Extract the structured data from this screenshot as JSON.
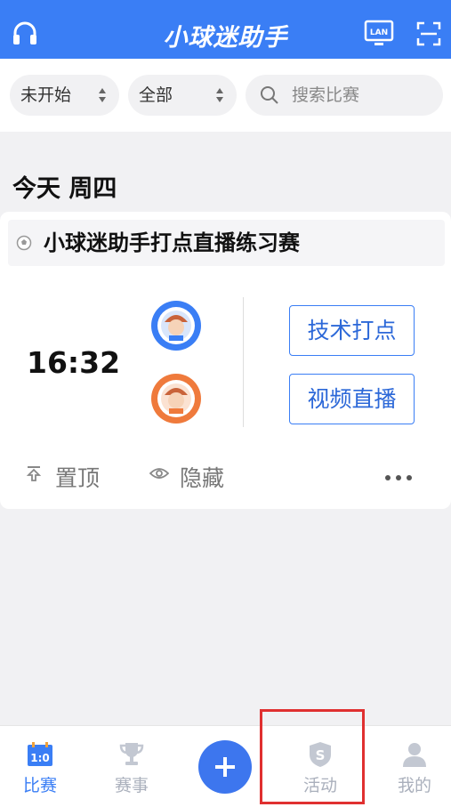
{
  "header": {
    "title": "小球迷助手",
    "icons": [
      "headset-icon",
      "lan-icon",
      "scan-icon"
    ]
  },
  "filters": {
    "status_value": "未开始",
    "category_value": "全部",
    "search_placeholder": "搜索比赛"
  },
  "day_heading": "今天 周四",
  "match": {
    "title": "小球迷助手打点直播练习赛",
    "time": "16:32",
    "home_team_color": "#3a7ef5",
    "away_team_color": "#ef7a3c",
    "btn_tech": "技术打点",
    "btn_video": "视频直播",
    "pin_label": "置顶",
    "hide_label": "隐藏"
  },
  "tabbar": {
    "tabs": [
      {
        "label": "比赛",
        "icon": "scoreboard-icon",
        "active": true
      },
      {
        "label": "赛事",
        "icon": "trophy-icon",
        "active": false
      },
      {
        "label": "活动",
        "icon": "shield-s-icon",
        "active": false
      },
      {
        "label": "我的",
        "icon": "user-icon",
        "active": false
      }
    ]
  },
  "colors": {
    "accent": "#3a7ef5",
    "highlight": "#e03030"
  }
}
